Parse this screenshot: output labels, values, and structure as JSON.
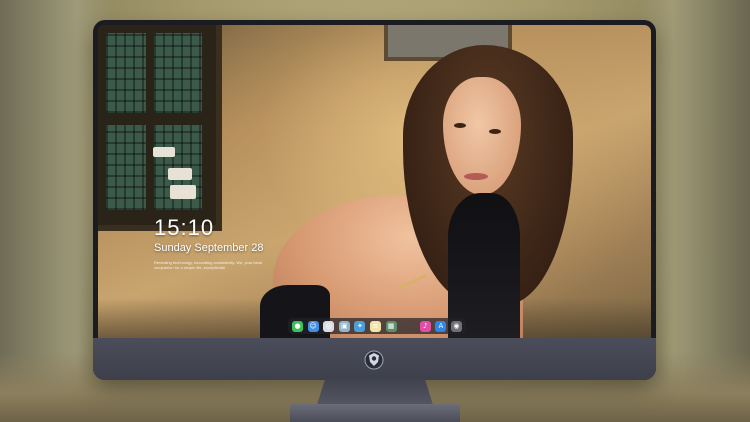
{
  "lock_screen": {
    "time": "15:10",
    "date": "Sunday September 28",
    "tagline": "Revealing technology, innovating consistently. We, your ideal companion for a simple life, exceptional!"
  },
  "dock": {
    "icons": [
      {
        "name": "messages-icon",
        "glyph": "●",
        "color": "#39c25a"
      },
      {
        "name": "finder-icon",
        "glyph": "☺",
        "color": "#3f8fe6"
      },
      {
        "name": "safari-icon",
        "glyph": "◎",
        "color": "#d9dde3"
      },
      {
        "name": "preview-icon",
        "glyph": "▣",
        "color": "#8fb6cf"
      },
      {
        "name": "imovie-icon",
        "glyph": "✦",
        "color": "#4a9fd8"
      },
      {
        "name": "notes-icon",
        "glyph": "≡",
        "color": "#f1e4a8"
      },
      {
        "name": "photo-icon",
        "glyph": "▦",
        "color": "#5f8f6a"
      },
      {
        "name": "music-icon",
        "glyph": "♪",
        "color": "#e04fa4"
      },
      {
        "name": "app-store-icon",
        "glyph": "A",
        "color": "#2f86e6"
      },
      {
        "name": "camera-icon",
        "glyph": "◉",
        "color": "#6f6f78"
      }
    ]
  },
  "monitor": {
    "logo_icon": "shield-logo-icon"
  }
}
